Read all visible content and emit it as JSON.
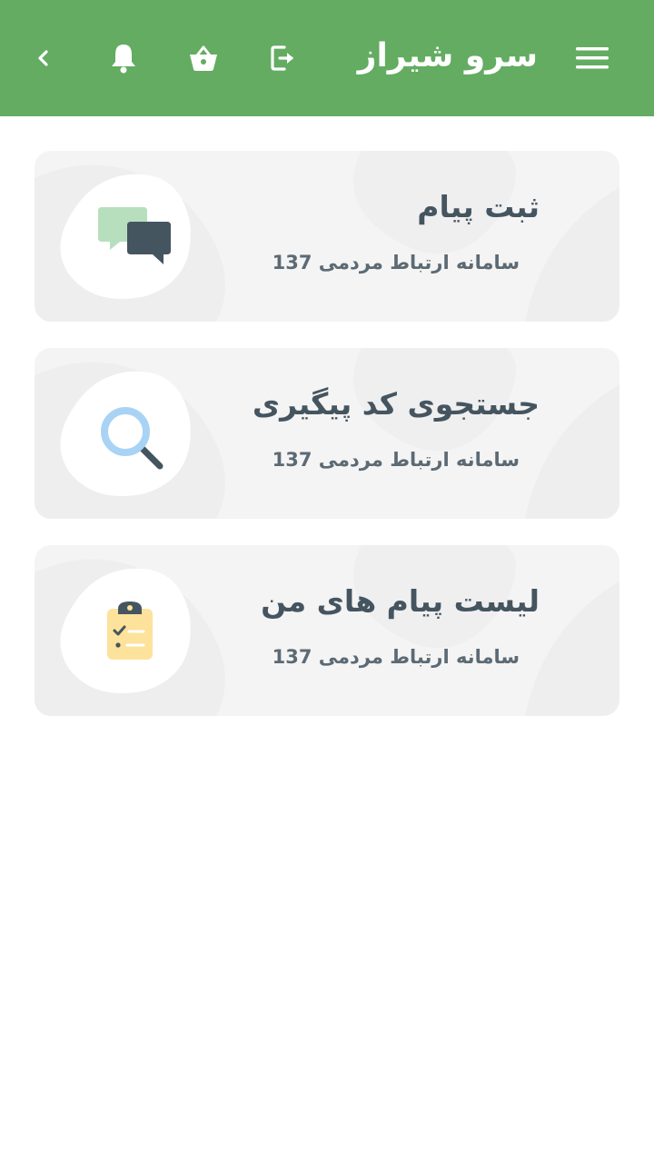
{
  "header": {
    "title": "سرو شیراز",
    "menu_icon": "hamburger-menu-icon",
    "logout_icon": "logout-icon",
    "basket_icon": "shopping-basket-icon",
    "bell_icon": "notification-bell-icon",
    "back_icon": "chevron-left-icon",
    "bar_color": "#63ac62"
  },
  "cards": [
    {
      "title": "ثبت پیام",
      "subtitle": "سامانه ارتباط مردمی 137",
      "icon": "chat-bubbles-icon"
    },
    {
      "title": "جستجوی کد پیگیری",
      "subtitle": "سامانه ارتباط مردمی 137",
      "icon": "magnifier-search-icon"
    },
    {
      "title": "لیست پیام های من",
      "subtitle": "سامانه ارتباط مردمی 137",
      "icon": "clipboard-checklist-icon"
    }
  ]
}
